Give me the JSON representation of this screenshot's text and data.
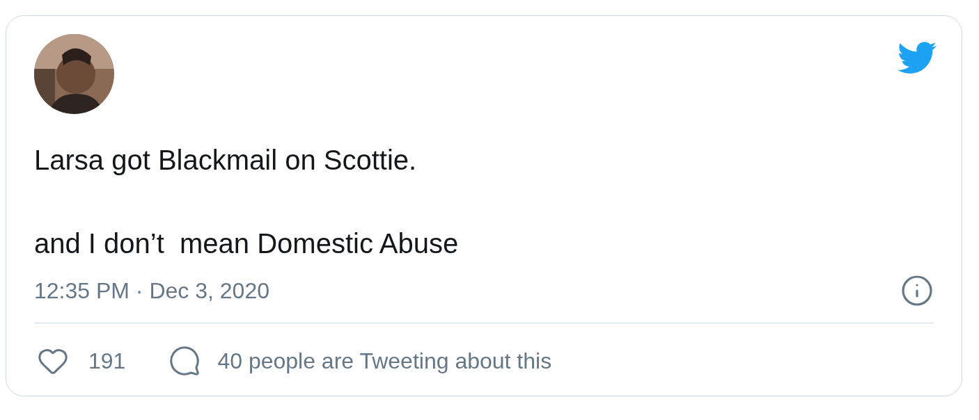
{
  "tweet": {
    "text": "Larsa got Blackmail on Scottie.\n\nand I don’t  mean Domestic Abuse",
    "timestamp": "12:35 PM · Dec 3, 2020",
    "likes": "191",
    "discussion": "40 people are Tweeting about this"
  }
}
